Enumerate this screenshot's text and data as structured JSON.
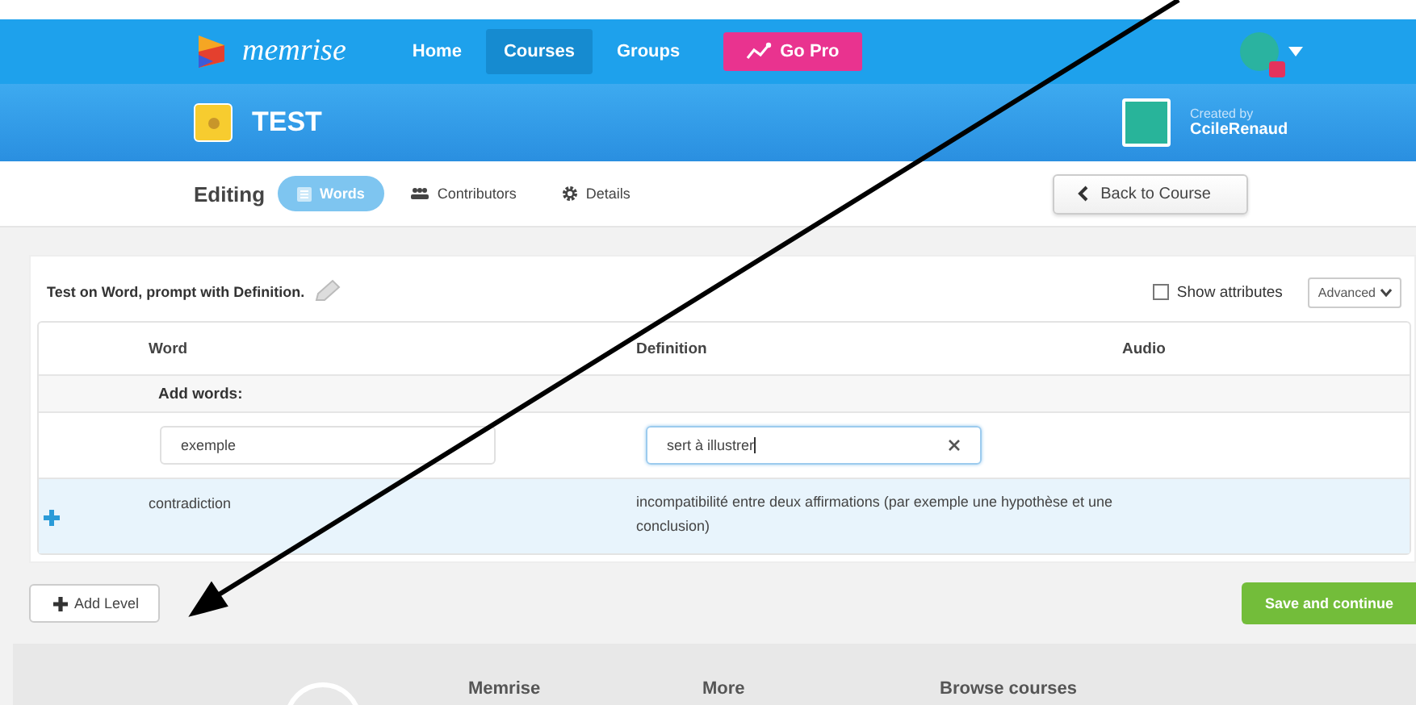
{
  "nav": {
    "logo": "memrise",
    "links": [
      {
        "label": "Home",
        "selected": false
      },
      {
        "label": "Courses",
        "selected": true
      },
      {
        "label": "Groups",
        "selected": false
      }
    ],
    "go_pro": "Go Pro"
  },
  "course": {
    "title": "TEST",
    "created_by_label": "Created by",
    "creator": "CcileRenaud"
  },
  "editing": {
    "label": "Editing",
    "tabs": [
      {
        "label": "Words",
        "selected": true,
        "kind": "list"
      },
      {
        "label": "Contributors",
        "selected": false,
        "kind": "people"
      },
      {
        "label": "Details",
        "selected": false,
        "kind": "gear"
      }
    ],
    "back_button": "Back to Course"
  },
  "panel": {
    "test_line": "Test on Word, prompt with Definition.",
    "show_attributes": {
      "label": "Show attributes",
      "checked": false
    },
    "advanced": "Advanced",
    "table": {
      "columns": [
        "Word",
        "Definition",
        "Audio"
      ],
      "add_words_label": "Add words:",
      "inputs": [
        {
          "value": "exemple",
          "focused": false
        },
        {
          "value": "sert à illustrer",
          "focused": true
        }
      ],
      "rows": [
        {
          "word": "contradiction",
          "definition": "incompatibilité entre deux affirmations (par exemple une hypothèse et une conclusion)"
        }
      ]
    }
  },
  "actions": {
    "add_level": "Add Level",
    "save": "Save and continue"
  },
  "footer": {
    "headings": [
      "Memrise",
      "More",
      "Browse courses"
    ]
  }
}
